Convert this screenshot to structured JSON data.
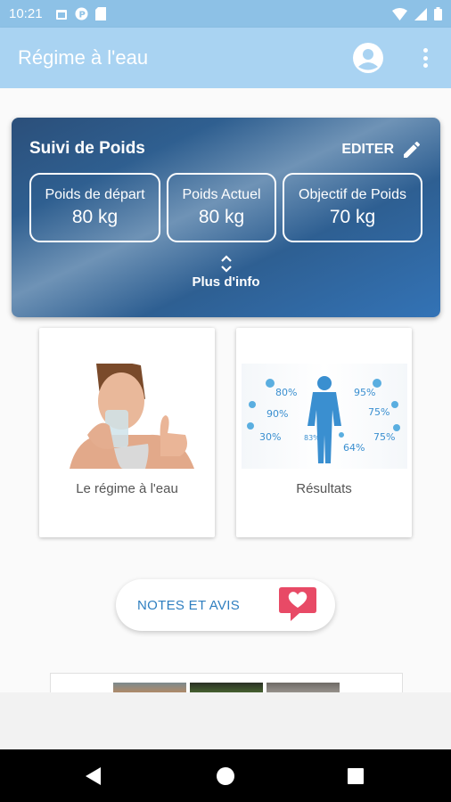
{
  "status_bar": {
    "time": "10:21"
  },
  "app_bar": {
    "title": "Régime à l'eau"
  },
  "weight_card": {
    "title": "Suivi de Poids",
    "edit_label": "EDITER",
    "stats": [
      {
        "label": "Poids de départ",
        "value": "80 kg"
      },
      {
        "label": "Poids Actuel",
        "value": "80 kg"
      },
      {
        "label": "Objectif de Poids",
        "value": "70 kg"
      }
    ],
    "more_info": "Plus d'info"
  },
  "tiles": [
    {
      "caption": "Le régime à l'eau"
    },
    {
      "caption": "Résultats"
    }
  ],
  "results_infographic": {
    "values": [
      "80%",
      "90%",
      "30%",
      "83%",
      "95%",
      "75%",
      "75%",
      "64%"
    ]
  },
  "notes_button": {
    "label": "NOTES ET AVIS"
  },
  "colors": {
    "accent": "#2f7fc0",
    "appbar": "#a9d3f2",
    "statusbar": "#8dc1e6",
    "heart": "#e84a66"
  }
}
